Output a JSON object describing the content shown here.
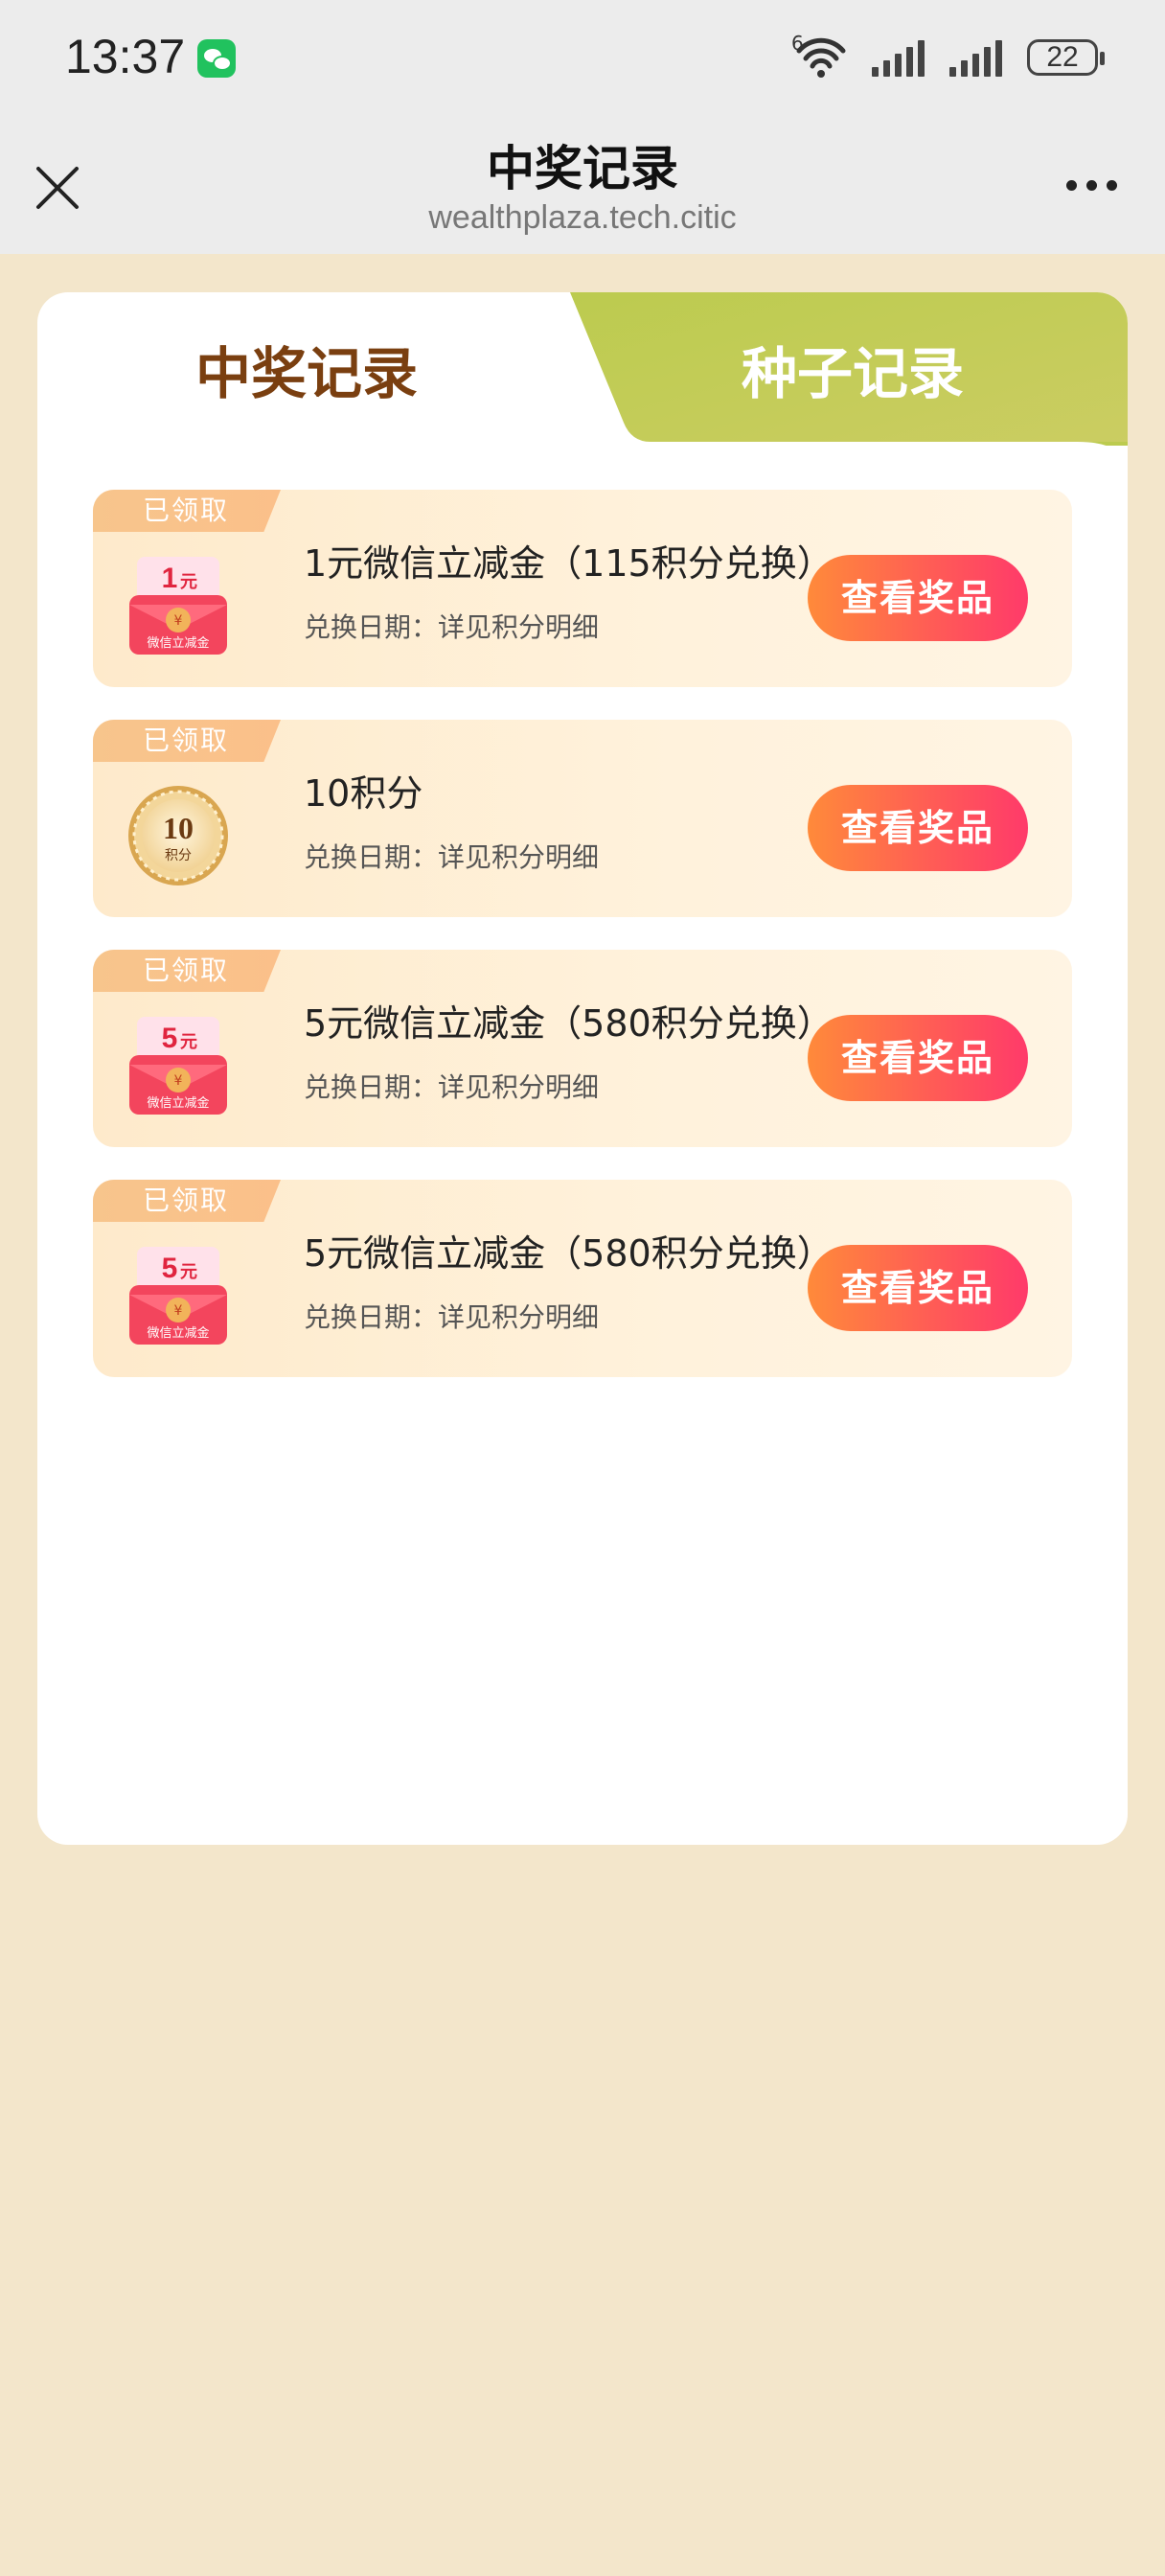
{
  "status_bar": {
    "time": "13:37",
    "app_notification_icon": "wechat-icon",
    "network_label": "6",
    "battery": "22"
  },
  "nav": {
    "title": "中奖记录",
    "subtitle": "wealthplaza.tech.citic",
    "close_icon": "close-icon",
    "more_icon": "more-icon"
  },
  "tabs": [
    {
      "label": "中奖记录",
      "active": true
    },
    {
      "label": "种子记录",
      "active": false
    }
  ],
  "records": [
    {
      "status": "已领取",
      "icon": "red-envelope-1-yuan-icon",
      "icon_amount": "1",
      "icon_unit": "元",
      "icon_caption": "微信立减金",
      "title": "1元微信立减金（115积分兑换）",
      "date": "兑换日期：详见积分明细",
      "button": "查看奖品"
    },
    {
      "status": "已领取",
      "icon": "points-coin-icon",
      "icon_amount": "10",
      "icon_unit": "积分",
      "title": "10积分",
      "date": "兑换日期：详见积分明细",
      "button": "查看奖品"
    },
    {
      "status": "已领取",
      "icon": "red-envelope-5-yuan-icon",
      "icon_amount": "5",
      "icon_unit": "元",
      "icon_caption": "微信立减金",
      "title": "5元微信立减金（580积分兑换）",
      "date": "兑换日期：详见积分明细",
      "button": "查看奖品"
    },
    {
      "status": "已领取",
      "icon": "red-envelope-5-yuan-icon",
      "icon_amount": "5",
      "icon_unit": "元",
      "icon_caption": "微信立减金",
      "title": "5元微信立减金（580积分兑换）",
      "date": "兑换日期：详见积分明细",
      "button": "查看奖品"
    }
  ],
  "colors": {
    "page_background": "#f3e6cb",
    "active_tab_text": "#7a3f10",
    "inactive_tab_background": "#c2cd58",
    "button_gradient_start": "#ff8a3a",
    "button_gradient_end": "#ff3a6a"
  }
}
